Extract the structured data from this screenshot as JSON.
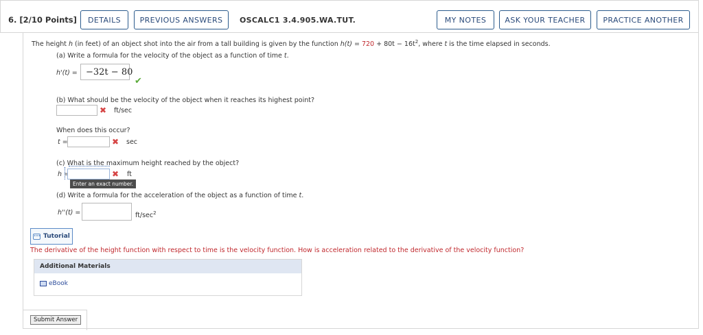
{
  "header": {
    "question_number": "6. [2/10 Points]",
    "details_label": "DETAILS",
    "previous_answers_label": "PREVIOUS ANSWERS",
    "question_code": "OSCALC1 3.4.905.WA.TUT.",
    "my_notes_label": "MY NOTES",
    "ask_teacher_label": "ASK YOUR TEACHER",
    "practice_another_label": "PRACTICE ANOTHER"
  },
  "problem": {
    "intro_pre": "The height ",
    "intro_h": "h",
    "intro_mid": " (in feet) of an object shot into the air from a tall building is given by the function ",
    "func_lhs": "h(t) = ",
    "func_const": "720",
    "func_rest": " + 80t − 16t",
    "func_exp": "2",
    "intro_post": ", where ",
    "intro_t": "t",
    "intro_end": " is the time elapsed in seconds."
  },
  "part_a": {
    "prompt": "(a) Write a formula for the velocity of the object as a function of time ",
    "prompt_var": "t",
    "prompt_end": ".",
    "label": "h'(t) =",
    "answer": "−32t − 80",
    "status": "✔"
  },
  "part_b": {
    "prompt": "(b) What should be the velocity of the object when it reaches its highest point?",
    "value": "",
    "unit": "ft/sec",
    "status": "✖",
    "followup": "When does this occur?",
    "t_label": "t =",
    "t_value": "",
    "t_unit": "sec",
    "t_status": "✖"
  },
  "part_c": {
    "prompt": "(c) What is the maximum height reached by the object?",
    "label": "h =",
    "value": "",
    "unit": "ft",
    "status": "✖",
    "tooltip": "Enter an exact number."
  },
  "part_d": {
    "prompt_pre": "(d) Write a formula for the acceleration of the object as a function of time ",
    "prompt_var": "t",
    "prompt_end": ".",
    "label": "h''(t) =",
    "value": "",
    "unit": "ft/sec",
    "unit_exp": "2"
  },
  "tutorial": {
    "label": "Tutorial",
    "hint": "The derivative of the height function with respect to time is the velocity function. How is acceleration related to the derivative of the velocity function?"
  },
  "additional_materials": {
    "heading": "Additional Materials",
    "ebook_label": "eBook"
  },
  "submit_label": "Submit Answer"
}
